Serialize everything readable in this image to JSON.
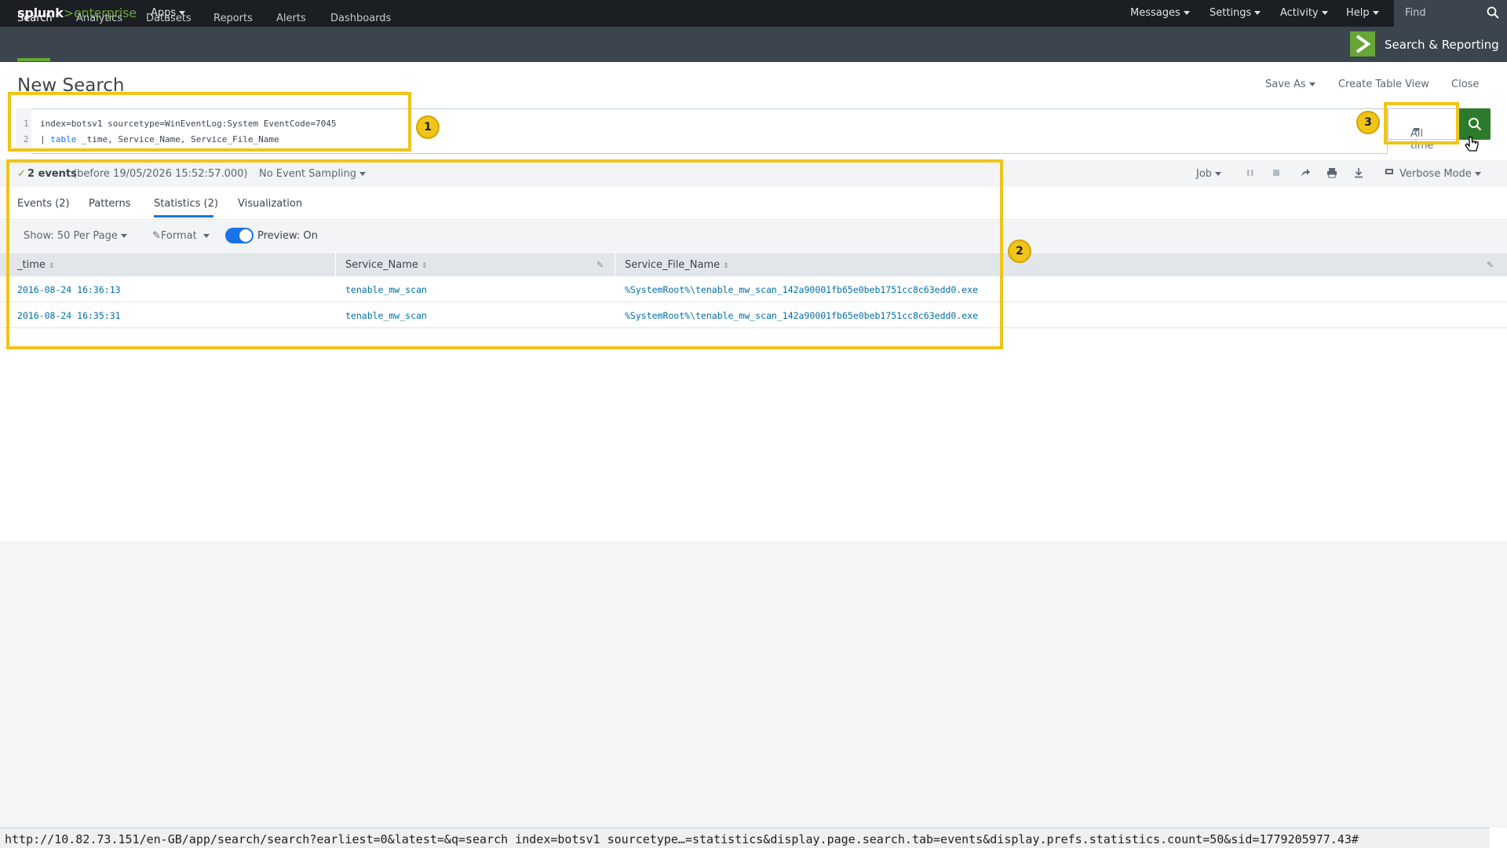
{
  "topbar": {
    "logo_main": "splunk",
    "logo_product": ">enterprise",
    "apps_label": "Apps",
    "nav": [
      "Messages",
      "Settings",
      "Activity",
      "Help"
    ],
    "find_placeholder": "Find"
  },
  "appbar": {
    "tabs": [
      "Search",
      "Analytics",
      "Datasets",
      "Reports",
      "Alerts",
      "Dashboards"
    ],
    "active_tab": "Search",
    "app_title": "Search & Reporting"
  },
  "header": {
    "title": "New Search",
    "save_as": "Save As",
    "create_table_view": "Create Table View",
    "close": "Close"
  },
  "search": {
    "line_numbers": [
      "1",
      "2"
    ],
    "line1": "index=botsv1 sourcetype=WinEventLog:System EventCode=7045",
    "line2_pipe": "| ",
    "line2_keyword": "table",
    "line2_rest": " _time, Service_Name, Service_File_Name",
    "time_range": "All time"
  },
  "status": {
    "check": "✓",
    "events_count": "2 events",
    "events_detail": "(before 19/05/2026 15:52:57.000)",
    "sampling": "No Event Sampling",
    "job": "Job",
    "mode": "Verbose Mode"
  },
  "result_tabs": [
    "Events (2)",
    "Patterns",
    "Statistics (2)",
    "Visualization"
  ],
  "active_result_tab": "Statistics (2)",
  "controls": {
    "show": "Show: 50 Per Page",
    "format": "Format",
    "preview": "Preview: On"
  },
  "table": {
    "columns": [
      "_time",
      "Service_Name",
      "Service_File_Name"
    ],
    "rows": [
      [
        "2016-08-24 16:36:13",
        "tenable_mw_scan",
        "%SystemRoot%\\tenable_mw_scan_142a90001fb65e0beb1751cc8c63edd0.exe"
      ],
      [
        "2016-08-24 16:35:31",
        "tenable_mw_scan",
        "%SystemRoot%\\tenable_mw_scan_142a90001fb65e0beb1751cc8c63edd0.exe"
      ]
    ]
  },
  "annotations": [
    "1",
    "2",
    "3"
  ],
  "status_url": "http://10.82.73.151/en-GB/app/search/search?earliest=0&latest=&q=search index=botsv1 sourcetype…=statistics&display.page.search.tab=events&display.prefs.statistics.count=50&sid=1779205977.43#",
  "colors": {
    "accent_green": "#65a637",
    "link_blue": "#006eaa",
    "annotation_yellow": "#f0c419",
    "topbar_bg": "#1b1e22",
    "appbar_bg": "#3c444d"
  },
  "icons": [
    "search-icon",
    "pause-icon",
    "stop-icon",
    "share-icon",
    "print-icon",
    "download-icon",
    "pencil-icon",
    "mode-icon",
    "cursor-icon",
    "check-icon",
    "sort-icon"
  ]
}
